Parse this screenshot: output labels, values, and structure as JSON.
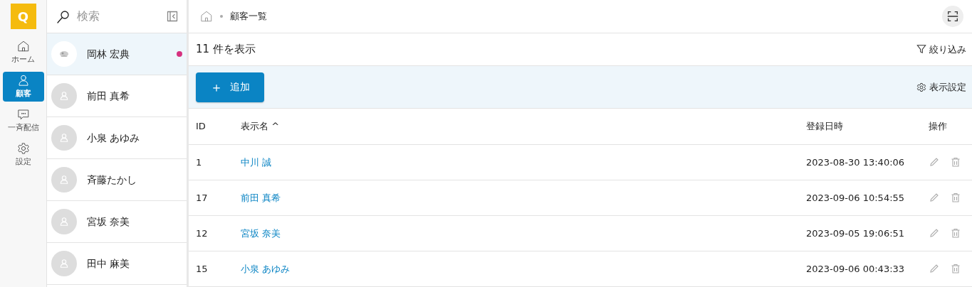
{
  "app": {
    "logo": "Q"
  },
  "rail": [
    {
      "kind": "home",
      "label": "ホーム",
      "selected": false
    },
    {
      "kind": "person",
      "label": "顧客",
      "selected": true
    },
    {
      "kind": "chat",
      "label": "一斉配信",
      "selected": false
    },
    {
      "kind": "gear",
      "label": "設定",
      "selected": false
    }
  ],
  "contacts_panel": {
    "search": {
      "placeholder": "検索"
    },
    "contacts": [
      {
        "name": "岡林 宏典",
        "photo": true,
        "selected": true,
        "unread": true
      },
      {
        "name": "前田 真希",
        "photo": false,
        "selected": false,
        "unread": false
      },
      {
        "name": "小泉 あゆみ",
        "photo": false,
        "selected": false,
        "unread": false
      },
      {
        "name": "斉藤たかし",
        "photo": false,
        "selected": false,
        "unread": false
      },
      {
        "name": "宮坂 奈美",
        "photo": false,
        "selected": false,
        "unread": false
      },
      {
        "name": "田中 麻美",
        "photo": false,
        "selected": false,
        "unread": false
      }
    ]
  },
  "breadcrumb": [
    "顧客一覧"
  ],
  "count": "11 件を表示",
  "filter": "絞り込み",
  "add_button": {
    "icon": "＋",
    "label": "追加"
  },
  "display_settings": "表示設定",
  "table": {
    "columns": [
      {
        "label": "ID"
      },
      {
        "label": "表示名",
        "sort_mark": "^"
      },
      {
        "label": "登録日時"
      },
      {
        "label": "操作"
      }
    ],
    "rows": [
      {
        "id": "1",
        "name": "中川 誠",
        "created": "2023-08-30 13:40:06"
      },
      {
        "id": "17",
        "name": "前田 真希",
        "created": "2023-09-06 10:54:55"
      },
      {
        "id": "12",
        "name": "宮坂 奈美",
        "created": "2023-09-05 19:06:51"
      },
      {
        "id": "15",
        "name": "小泉 あゆみ",
        "created": "2023-09-06 00:43:33"
      }
    ]
  }
}
